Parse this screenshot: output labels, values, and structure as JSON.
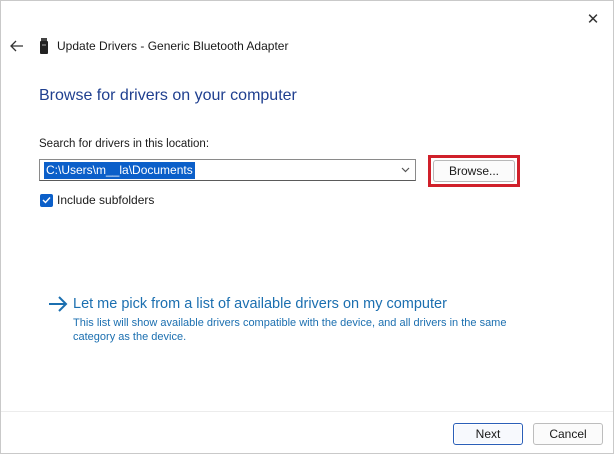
{
  "window": {
    "close_glyph": "✕",
    "title": "Update Drivers - Generic Bluetooth Adapter"
  },
  "heading": "Browse for drivers on your computer",
  "search": {
    "label": "Search for drivers in this location:",
    "path": "C:\\Users\\m__la\\Documents",
    "browse_label": "Browse...",
    "include_subfolders_label": "Include subfolders",
    "include_subfolders_checked": true
  },
  "pick": {
    "title": "Let me pick from a list of available drivers on my computer",
    "description": "This list will show available drivers compatible with the device, and all drivers in the same category as the device."
  },
  "footer": {
    "next_label": "Next",
    "cancel_label": "Cancel"
  },
  "colors": {
    "accent": "#0b5fc9",
    "heading": "#1f3f8f",
    "link": "#1b6fb0",
    "highlight": "#d0202a"
  }
}
